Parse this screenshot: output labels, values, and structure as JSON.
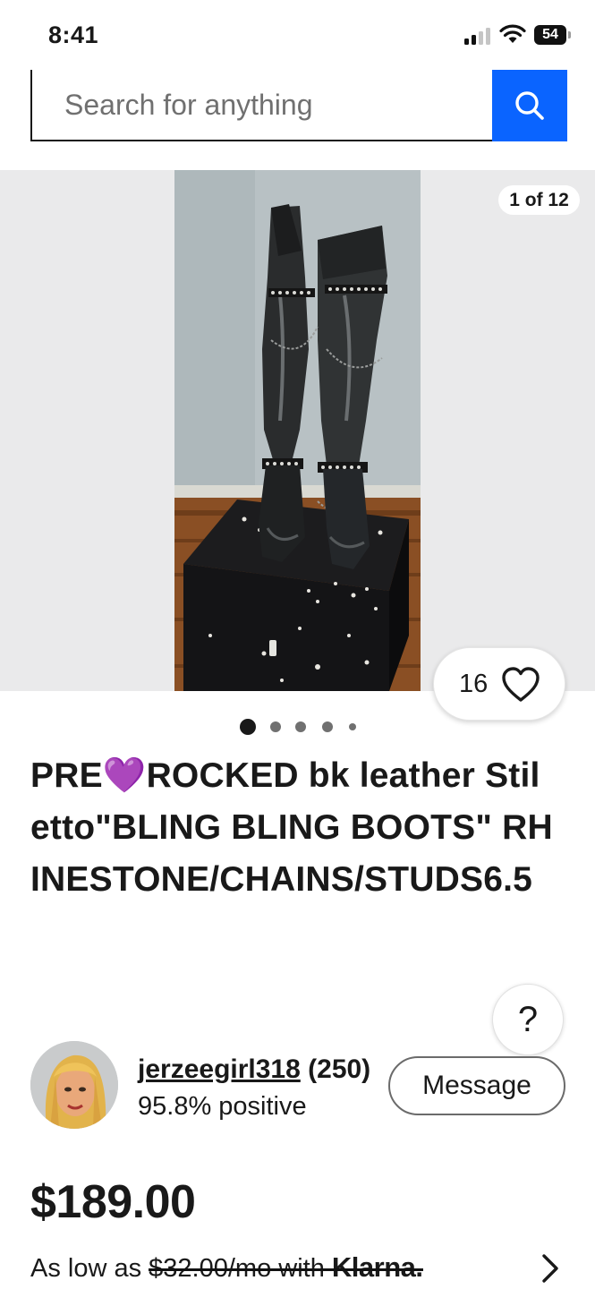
{
  "status_bar": {
    "time": "8:41",
    "battery": "54"
  },
  "search": {
    "placeholder": "Search for anything",
    "button_icon": "search-icon"
  },
  "gallery": {
    "counter": "1 of 12",
    "watch_count": "16",
    "watch_icon": "heart-icon",
    "page_dots": 5,
    "active_dot": 0
  },
  "listing": {
    "title_part1": "PRE",
    "title_emoji": "💜",
    "title_part2": "ROCKED bk leather Stiletto\"BLING BLING BOOTS\" RHINESTONE/CHAINS/STUDS6.5"
  },
  "help": {
    "label": "?"
  },
  "seller": {
    "name": "jerzeegirl318",
    "feedback_count": "(250)",
    "feedback": "95.8% positive",
    "message_label": "Message"
  },
  "price": {
    "amount": "$189.00",
    "financing_prefix": "As low as ",
    "financing_amount": "$32.00/mo with ",
    "financing_provider": "Klarna."
  },
  "colors": {
    "brand_blue": "#0a64ff",
    "text": "#191919",
    "gallery_bg": "#eaeaeb"
  }
}
